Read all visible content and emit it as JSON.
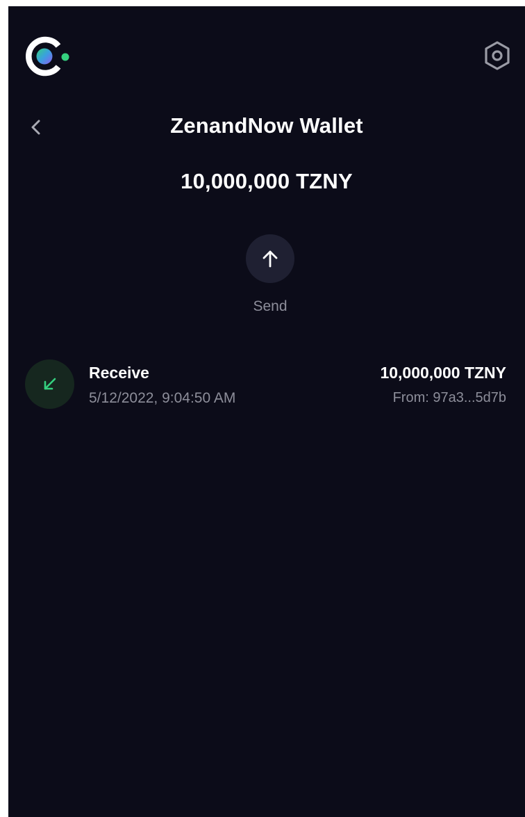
{
  "header": {
    "logo_icon": "celo-logo-icon",
    "settings_icon": "settings-hexagon-icon"
  },
  "wallet": {
    "back_icon": "chevron-left-icon",
    "title": "ZenandNow Wallet",
    "balance": "10,000,000 TZNY"
  },
  "actions": {
    "send_icon": "arrow-up-icon",
    "send_label": "Send"
  },
  "transactions": [
    {
      "icon": "arrow-down-left-icon",
      "type": "Receive",
      "date": "5/12/2022, 9:04:50 AM",
      "amount": "10,000,000 TZNY",
      "from": "From: 97a3...5d7b"
    }
  ],
  "colors": {
    "background": "#0c0c19",
    "button_bg": "#1f2032",
    "receive_accent": "#35d07f",
    "receive_bg": "#16271f",
    "muted_text": "#8d8e9a"
  }
}
